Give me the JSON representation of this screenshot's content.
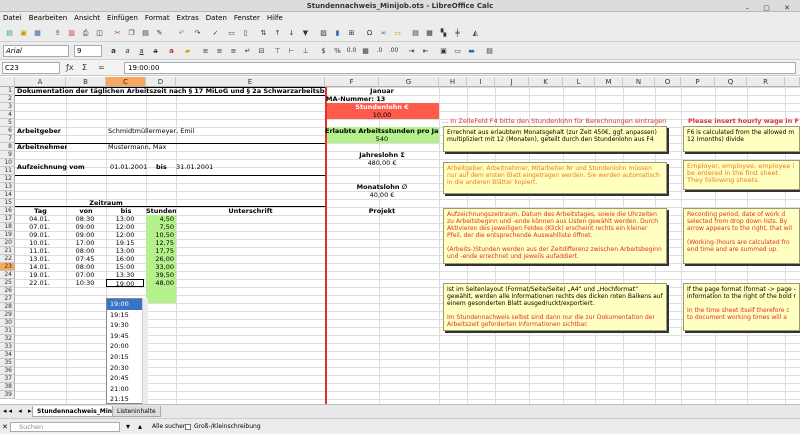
{
  "window": {
    "title": "Stundennachweis_Minijob.ots - LibreOffice Calc"
  },
  "menu": [
    "Datei",
    "Bearbeiten",
    "Ansicht",
    "Einfügen",
    "Format",
    "Extras",
    "Daten",
    "Fenster",
    "Hilfe"
  ],
  "toolbar": {
    "font_name": "Arial",
    "font_size": "9"
  },
  "formula": {
    "cell_ref": "C23",
    "content": "19:00:00"
  },
  "columns": [
    "A",
    "B",
    "C",
    "D",
    "E",
    "F",
    "G",
    "H",
    "I",
    "J",
    "K",
    "L",
    "M",
    "N",
    "O",
    "P",
    "Q",
    "R"
  ],
  "rows": [
    "1",
    "2",
    "3",
    "4",
    "5",
    "6",
    "7",
    "8",
    "9",
    "10",
    "11",
    "12",
    "13",
    "14",
    "15",
    "16",
    "17",
    "18",
    "19",
    "20",
    "21",
    "22",
    "23",
    "24",
    "25",
    "26",
    "27",
    "28",
    "29",
    "30",
    "31",
    "32",
    "33",
    "34",
    "35",
    "36",
    "37",
    "38",
    "39"
  ],
  "sheet": {
    "title": "Dokumentation der täglichen Arbeitszeit nach § 17 MiLoG und § 2a Schwarzarbeitsbekämpfungsgesetz",
    "arbeitgeber_label": "Arbeitgeber",
    "arbeitgeber_value": "Schmidtmüllermeyer, Emil",
    "arbeitnehmer_label": "Arbeitnehmer",
    "arbeitnehmer_value": "Mustermann, Max",
    "aufzeichnung_label": "Aufzeichnung vom",
    "aufzeichnung_von": "01.01.2001",
    "bis_label": "bis",
    "aufzeichnung_bis": "31.01.2001",
    "zeitraum": "Zeitraum",
    "headers": {
      "tag": "Tag",
      "von": "von",
      "bis": "bis",
      "stunden": "Stunden",
      "unterschrift": "Unterschrift",
      "projekt": "Projekt"
    },
    "entries": [
      {
        "tag": "04.01.",
        "von": "08:30",
        "bis": "13:00",
        "stunden": "4,50"
      },
      {
        "tag": "07.01.",
        "von": "09:00",
        "bis": "12:00",
        "stunden": "7,50"
      },
      {
        "tag": "09.01.",
        "von": "09:00",
        "bis": "12:00",
        "stunden": "10,50"
      },
      {
        "tag": "10.01.",
        "von": "17:00",
        "bis": "19:15",
        "stunden": "12,75"
      },
      {
        "tag": "11.01.",
        "von": "08:00",
        "bis": "13:00",
        "stunden": "17,75"
      },
      {
        "tag": "13.01.",
        "von": "07:45",
        "bis": "16:00",
        "stunden": "26,00"
      },
      {
        "tag": "14.01.",
        "von": "08:00",
        "bis": "15:00",
        "stunden": "33,00"
      },
      {
        "tag": "19.01.",
        "von": "07:00",
        "bis": "13:30",
        "stunden": "39,50"
      },
      {
        "tag": "22.01.",
        "von": "10:30",
        "bis": "19:00",
        "stunden": "48,00"
      }
    ],
    "f_month": "Januar",
    "f_ma_nummer": "MA-Nummer: 13",
    "f_stundenlohn_label": "Stundenlohn €",
    "f_stundenlohn_value": "10,00",
    "f_erlaubte_label": "Erlaubte Arbeitsstunden pro Jahr",
    "f_erlaubte_value": "540",
    "f_jahreslohn_label": "Jahreslohn Σ",
    "f_jahreslohn_value": "480,00 €",
    "f_monatslohn_label": "Monatslohn ∅",
    "f_monatslohn_value": "40,00 €"
  },
  "notes": {
    "n1_red": "... In ZelleFeld F4 bitte den Stundenlohn für Berechnungen eintragen",
    "n1": "Errechnet aus erlaubtem Monatsgehalt (zur Zeit 450€, ggf. anpassen) multipliziert mit 12 (Monaten), geteilt durch den Stundenlohn aus F4",
    "n2": "Arbeitgeber, Arbeitnehmer, Mitarbeiter-Nr und Stundenlohn müssen nur auf dem ersten Blatt eingetragen werden. Sie werden automatisch in die anderen Blätter kopiert.",
    "n3": "Aufzeichnungszeitraum, Datum des Arbeitstages, sowie die Uhrzeiten zu Arbeitsbeginn und -ende können aus Listen gewählt werden. Durch Aktivieren des jeweiligen Feldes (Klick) erscheint rechts ein kleiner Pfeil, der die entsprechende Auswahlliste öffnet.",
    "n3b": "(Arbeits-)Stunden werden aus der Zeitdifferenz zwischen Arbeitsbeginn und -ende errechnet und jeweils aufaddiert.",
    "n4": "Ist im Seitenlayout (Format/Seite/Seite) „A4“ und „Hochformat“ gewählt, werden alle Informationen rechts des dicken roten Balkens auf einem gesonderten Blatt ausgedruckt/exportiert.",
    "n4b": "Im Stundennachweis selbst sind dann nur die zur Dokumentation der Arbeitszeit geforderten Informationen sichtbar.",
    "e_red": "Please insert hourly wage in F",
    "e1": "F6 is calculated from the allowed m 12 (months) divide",
    "e2": "Employer, employee, employee i be entered in the first sheet. They following sheets.",
    "e3": "Recording period, date of work d selected from drop down lists. By arrow appears to the right, that wil",
    "e3b": "(Working-)hours are calculated fro end time and are summed up.",
    "e4": "If the page format (format -> page - information to the right of the bold r",
    "e4b": "In the time sheet itself therefore c to document working times will a"
  },
  "dropdown": [
    "19:00",
    "19:15",
    "19:30",
    "19:45",
    "20:00",
    "20:15",
    "20:30",
    "20:45",
    "21:00",
    "21:15",
    "21:30"
  ],
  "tabs": {
    "active": "Stundennachweis_Minijob",
    "second": "Listeninhalte"
  },
  "findbar": {
    "placeholder": "Suchen",
    "alle": "Alle suchen",
    "gross": "Groß-/Kleinschreibung"
  }
}
